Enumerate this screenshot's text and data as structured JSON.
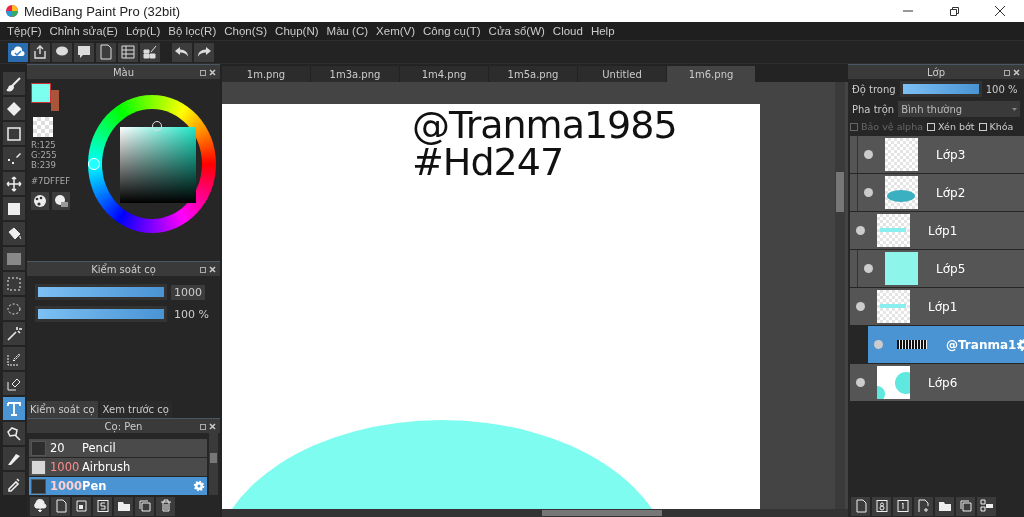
{
  "window": {
    "title": "MediBang Paint Pro (32bit)"
  },
  "menu": [
    "Tệp(F)",
    "Chỉnh sửa(E)",
    "Lớp(L)",
    "Bộ lọc(R)",
    "Chọn(S)",
    "Chụp(N)",
    "Màu (C)",
    "Xem(V)",
    "Công cụ(T)",
    "Cửa sổ(W)",
    "Cloud",
    "Help"
  ],
  "toolbar": [
    {
      "kind": "cloud",
      "selected": true
    },
    {
      "kind": "share",
      "selected": false
    },
    {
      "kind": "bubble",
      "selected": false
    },
    {
      "kind": "comment",
      "selected": false
    },
    {
      "kind": "page",
      "selected": false
    },
    {
      "kind": "list",
      "selected": false
    },
    {
      "kind": "grid",
      "selected": false
    },
    {
      "kind": "undo",
      "selected": false
    },
    {
      "kind": "redo",
      "selected": false
    }
  ],
  "tools": [
    {
      "kind": "brush",
      "selected": false
    },
    {
      "kind": "eraser",
      "selected": false
    },
    {
      "kind": "shape",
      "selected": false
    },
    {
      "kind": "dots",
      "selected": false
    },
    {
      "kind": "move",
      "selected": false
    },
    {
      "kind": "fill",
      "selected": false
    },
    {
      "kind": "bucket",
      "selected": false
    },
    {
      "kind": "gradient",
      "selected": false
    },
    {
      "kind": "select",
      "selected": false
    },
    {
      "kind": "lasso",
      "selected": false
    },
    {
      "kind": "wand",
      "selected": false
    },
    {
      "kind": "selpen",
      "selected": false
    },
    {
      "kind": "selerase",
      "selected": false
    },
    {
      "kind": "text",
      "selected": true
    },
    {
      "kind": "operation",
      "selected": false
    },
    {
      "kind": "knife",
      "selected": false
    },
    {
      "kind": "dropper",
      "selected": false
    }
  ],
  "color_panel": {
    "title": "Màu",
    "swatches": [
      {
        "kind": "background",
        "color": "#a9553c"
      },
      {
        "kind": "foreground",
        "color": "#7dffef"
      }
    ],
    "r": "R:125",
    "g": "G:255",
    "b": "B:239",
    "hex": "#7DFFEF"
  },
  "brush_control": {
    "title": "Kiểm soát cọ",
    "size": {
      "level": 1,
      "value": "1000"
    },
    "opacity": {
      "level": 1,
      "value": "100 %"
    }
  },
  "panel_tabs": [
    {
      "label": "Kiểm soát cọ",
      "selected": true
    },
    {
      "label": "Xem trước cọ",
      "selected": false
    }
  ],
  "brush_panel": {
    "title": "Cọ: Pen",
    "brushes": [
      {
        "size": "20",
        "name": "Pencil",
        "color": "#2e2e2e",
        "highlighted": false,
        "selected": false
      },
      {
        "size": "1000",
        "name": "Airbrush",
        "color": "#d8d8d8",
        "highlighted": true,
        "selected": false
      },
      {
        "size": "1000",
        "name": "Pen",
        "color": "#2e2e2e",
        "highlighted": true,
        "selected": true
      }
    ]
  },
  "documents": [
    {
      "label": "1m.png",
      "selected": false
    },
    {
      "label": "1m3a.png",
      "selected": false
    },
    {
      "label": "1m4.png",
      "selected": false
    },
    {
      "label": "1m5a.png",
      "selected": false
    },
    {
      "label": "Untitled",
      "selected": false
    },
    {
      "label": "1m6.png",
      "selected": true
    }
  ],
  "canvas": {
    "lines": [
      "@Tranma1985",
      "#Hd247"
    ]
  },
  "layer_panel": {
    "title": "Lớp",
    "opacity_label": "Độ trong",
    "opacity": {
      "level": 1,
      "value": "100 %"
    },
    "blend_label": "Pha trộn",
    "blend_value": "Bình thường",
    "options": [
      {
        "label": "Bảo vệ alpha",
        "checked": false,
        "disabled": true
      },
      {
        "label": "Xén bớt",
        "checked": false,
        "disabled": false
      },
      {
        "label": "Khóa",
        "checked": false,
        "disabled": false
      }
    ],
    "layers": [
      {
        "name": "Lớp1",
        "kind": "text",
        "selected": false,
        "visible": true,
        "children": [
          {
            "name": "Lớp3",
            "kind": "empty",
            "selected": false,
            "visible": true
          },
          {
            "name": "Lớp2",
            "kind": "blob",
            "selected": false,
            "visible": true
          }
        ]
      },
      {
        "name": "Lớp1",
        "kind": "text",
        "selected": false,
        "visible": true,
        "children": [
          {
            "name": "Lớp5",
            "kind": "cyan",
            "selected": false,
            "visible": true
          }
        ]
      },
      {
        "name": "@Tranma1",
        "kind": "dark",
        "selected": true,
        "visible": true
      },
      {
        "name": "Lớp6",
        "kind": "dots",
        "selected": false,
        "visible": true
      }
    ]
  }
}
